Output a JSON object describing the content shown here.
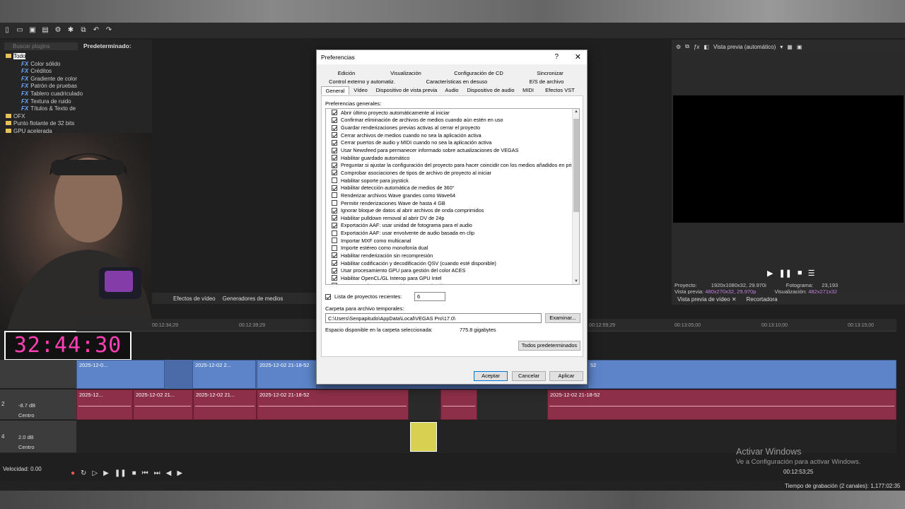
{
  "app": {
    "search_placeholder": "Buscar plugins",
    "preset_label": "Predeterminado:",
    "tree": [
      {
        "type": "folder",
        "label": "Todo"
      },
      {
        "type": "fx",
        "label": "Color sólido"
      },
      {
        "type": "fx",
        "label": "Créditos"
      },
      {
        "type": "fx",
        "label": "Gradiente de color"
      },
      {
        "type": "fx",
        "label": "Patrón de pruebas"
      },
      {
        "type": "fx",
        "label": "Tablero cuadriculado"
      },
      {
        "type": "fx",
        "label": "Textura de ruido"
      },
      {
        "type": "fx",
        "label": "Títulos & Texto de"
      },
      {
        "type": "folder",
        "label": "OFX"
      },
      {
        "type": "folder",
        "label": "Punto flotante de 32 bits"
      },
      {
        "type": "folder",
        "label": "GPU acelerada"
      }
    ],
    "timer": "32:44:30",
    "bottom_tabs": [
      "Efectos de vídeo",
      "Generadores de medios"
    ],
    "preview": {
      "mode": "Vista previa (automático)",
      "project_label": "Proyecto:",
      "project_value": "1920x1080x32, 29.970i",
      "preview_label": "Vista previa:",
      "preview_value": "480x270x32, 29.970p",
      "frame_label": "Fotograma:",
      "frame_value": "23,193",
      "display_label": "Visualización:",
      "display_value": "482x271x32",
      "tabs": [
        "Vista previa de vídeo",
        "Recortadora"
      ]
    },
    "ruler_marks": [
      "00:12:34;29",
      "00:12:39;29",
      "00:12:59;29",
      "00:13:05;00",
      "00:13:10;00",
      "00:13:15;00"
    ],
    "tracks": {
      "track2": {
        "number": "2",
        "level": "-8.7 dB",
        "pan": "Centro"
      },
      "track4": {
        "number": "4",
        "level": "2.0 dB",
        "pan": "Centro"
      }
    },
    "video_clips": [
      "2025-12-0...",
      "2025-12-02 2...",
      "2025-12-02 21-18-52",
      "52"
    ],
    "audio_clips": [
      "2025-12...",
      "2025-12-02 21...",
      "2025-12-02 21...",
      "2025-12-02 21-18-52",
      "2025-12-02 21-18-52"
    ],
    "speed": "Velocidad: 0.00",
    "timecode": "00:12:53;25",
    "record_time": "Tiempo de grabación (2 canales): 1,177:02:35",
    "activate_title": "Activar Windows",
    "activate_sub": "Ve a Configuración para activar Windows."
  },
  "dialog": {
    "title": "Preferencias",
    "help": "?",
    "close": "✕",
    "tabs_row1": [
      "Edición",
      "Visualización",
      "Configuración de CD",
      "Sincronizar"
    ],
    "tabs_row2": [
      "Control externo y automatiz.",
      "Características en desuso",
      "E/S de archivo"
    ],
    "tabs_row3": [
      "General",
      "Vídeo",
      "Dispositivo de vista previa",
      "Audio",
      "Dispositivo de audio",
      "MIDI",
      "Efectos VST"
    ],
    "section_label": "Preferencias generales:",
    "options": [
      {
        "checked": true,
        "label": "Abrir último proyecto automáticamente al iniciar"
      },
      {
        "checked": true,
        "label": "Confirmar eliminación de archivos de medios cuando aún estén en uso"
      },
      {
        "checked": true,
        "label": "Guardar renderizaciones previas activas al cerrar el proyecto"
      },
      {
        "checked": true,
        "label": "Cerrar archivos de medios cuando no sea la aplicación activa"
      },
      {
        "checked": true,
        "label": "Cerrar puertos de audio y MIDI cuando no sea la aplicación activa"
      },
      {
        "checked": true,
        "label": "Usar Newsfeed para permanecer informado sobre actualizaciones de VEGAS"
      },
      {
        "checked": true,
        "label": "Habilitar guardado automático"
      },
      {
        "checked": true,
        "label": "Preguntar si ajustar la configuración del proyecto para hacer coincidir con los medios añadidos en prim"
      },
      {
        "checked": true,
        "label": "Comprobar asociaciones de tipos de archivo de proyecto al iniciar"
      },
      {
        "checked": false,
        "label": "Habilitar soporte para joystick"
      },
      {
        "checked": true,
        "label": "Habilitar detección automática de medios de 360°"
      },
      {
        "checked": false,
        "label": "Renderizar archivos Wave grandes como Wave64"
      },
      {
        "checked": false,
        "label": "Permitir renderizaciones Wave de hasta 4 GB"
      },
      {
        "checked": true,
        "label": "Ignorar bloque de datos al abrir archivos de onda comprimidos"
      },
      {
        "checked": true,
        "label": "Habilitar pulldown removal al abrir DV de 24p"
      },
      {
        "checked": true,
        "label": "Exportación AAF: usar unidad de fotograma para el audio"
      },
      {
        "checked": false,
        "label": "Exportación AAF: usar envolvente de audio basada en clip"
      },
      {
        "checked": false,
        "label": "Importar MXF como multicanal"
      },
      {
        "checked": false,
        "label": "Importe estéreo como monofonía dual"
      },
      {
        "checked": true,
        "label": "Habilitar renderización sin recompresión"
      },
      {
        "checked": true,
        "label": "Habilitar codificación y decodificación QSV (cuando esté disponible)"
      },
      {
        "checked": true,
        "label": "Usar procesamiento GPU para gestión del color ACES"
      },
      {
        "checked": true,
        "label": "Habilitar OpenCL/GL Interop para GPU Intel"
      },
      {
        "checked": true,
        "label": "Preguntar si mantener archivos tras grabación"
      }
    ],
    "recent_label": "Lista de proyectos recientes:",
    "recent_value": "6",
    "temp_folder_label": "Carpeta para archivo temporales:",
    "temp_folder_value": "C:\\Users\\Senpapitudo\\AppData\\Local\\VEGAS Pro\\17.0\\",
    "browse": "Examinar...",
    "space_label": "Espacio disponible en la carpeta seleccionada:",
    "space_value": "775.8 gigabytes",
    "defaults": "Todos predeterminados",
    "ok": "Aceptar",
    "cancel": "Cancelar",
    "apply": "Aplicar"
  }
}
